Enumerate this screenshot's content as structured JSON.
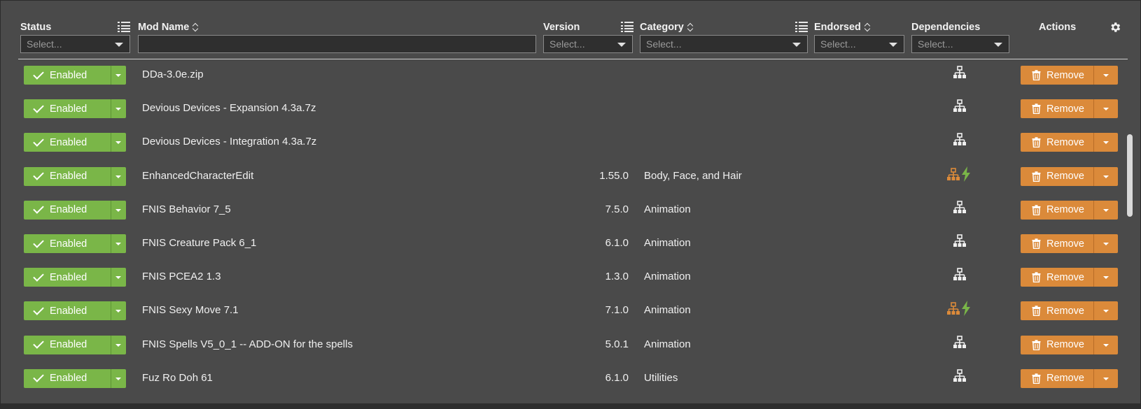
{
  "columns": {
    "status": "Status",
    "mod_name": "Mod Name",
    "version": "Version",
    "category": "Category",
    "endorsed": "Endorsed",
    "dependencies": "Dependencies",
    "actions": "Actions"
  },
  "filters": {
    "status_placeholder": "Select...",
    "version_placeholder": "Select...",
    "category_placeholder": "Select...",
    "endorsed_placeholder": "Select...",
    "dependencies_placeholder": "Select...",
    "mod_name_value": ""
  },
  "colors": {
    "enabled": "#7ab648",
    "remove": "#db8a3a",
    "background": "#4a4a4a",
    "dependency_warning": "#db8a3a",
    "bolt": "#7ab648"
  },
  "rows": [
    {
      "status": "Enabled",
      "name": "DDa-3.0e.zip",
      "version": "",
      "category": "",
      "dependency_icon": "hierarchy-icon",
      "action": "Remove"
    },
    {
      "status": "Enabled",
      "name": "Devious Devices - Expansion 4.3a.7z",
      "version": "",
      "category": "",
      "dependency_icon": "hierarchy-icon",
      "action": "Remove"
    },
    {
      "status": "Enabled",
      "name": "Devious Devices - Integration 4.3a.7z",
      "version": "",
      "category": "",
      "dependency_icon": "hierarchy-icon",
      "action": "Remove"
    },
    {
      "status": "Enabled",
      "name": "EnhancedCharacterEdit",
      "version": "1.55.0",
      "category": "Body, Face, and Hair",
      "dependency_icon": "hierarchy-bolt-icon",
      "action": "Remove"
    },
    {
      "status": "Enabled",
      "name": "FNIS Behavior 7_5",
      "version": "7.5.0",
      "category": "Animation",
      "dependency_icon": "hierarchy-icon",
      "action": "Remove"
    },
    {
      "status": "Enabled",
      "name": "FNIS Creature Pack 6_1",
      "version": "6.1.0",
      "category": "Animation",
      "dependency_icon": "hierarchy-icon",
      "action": "Remove"
    },
    {
      "status": "Enabled",
      "name": "FNIS PCEA2 1.3",
      "version": "1.3.0",
      "category": "Animation",
      "dependency_icon": "hierarchy-icon",
      "action": "Remove"
    },
    {
      "status": "Enabled",
      "name": "FNIS Sexy Move 7.1",
      "version": "7.1.0",
      "category": "Animation",
      "dependency_icon": "hierarchy-bolt-icon",
      "action": "Remove"
    },
    {
      "status": "Enabled",
      "name": "FNIS Spells V5_0_1 -- ADD-ON for the spells",
      "version": "5.0.1",
      "category": "Animation",
      "dependency_icon": "hierarchy-icon",
      "action": "Remove"
    },
    {
      "status": "Enabled",
      "name": "Fuz Ro Doh 61",
      "version": "6.1.0",
      "category": "Utilities",
      "dependency_icon": "hierarchy-icon",
      "action": "Remove"
    }
  ]
}
